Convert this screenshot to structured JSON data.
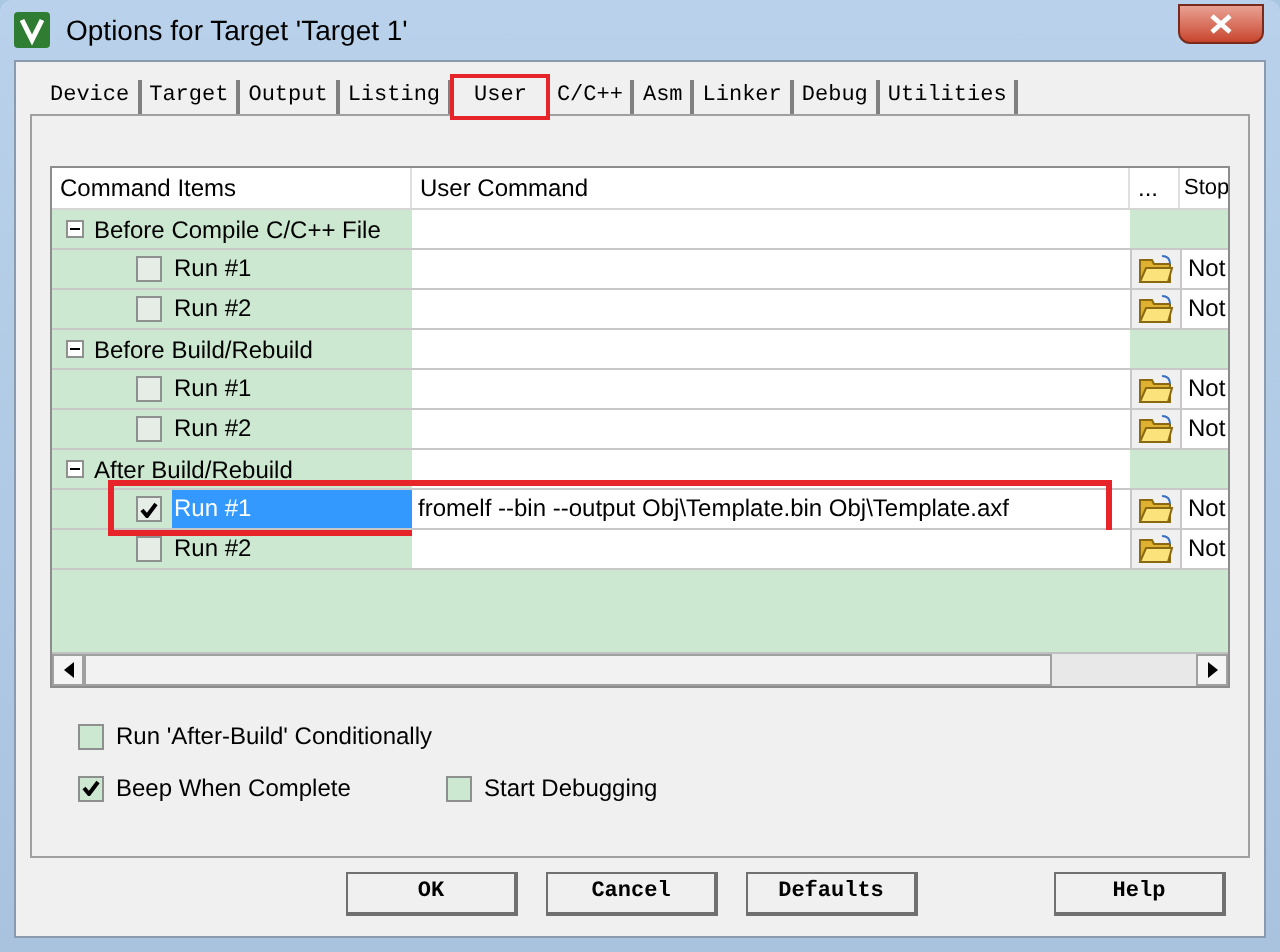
{
  "window": {
    "title": "Options for Target 'Target 1'"
  },
  "tabs": [
    {
      "label": "Device",
      "selected": false,
      "highlighted": false
    },
    {
      "label": "Target",
      "selected": false,
      "highlighted": false
    },
    {
      "label": "Output",
      "selected": false,
      "highlighted": false
    },
    {
      "label": "Listing",
      "selected": false,
      "highlighted": false
    },
    {
      "label": "User",
      "selected": true,
      "highlighted": true
    },
    {
      "label": "C/C++",
      "selected": false,
      "highlighted": false
    },
    {
      "label": "Asm",
      "selected": false,
      "highlighted": false
    },
    {
      "label": "Linker",
      "selected": false,
      "highlighted": false
    },
    {
      "label": "Debug",
      "selected": false,
      "highlighted": false
    },
    {
      "label": "Utilities",
      "selected": false,
      "highlighted": false
    }
  ],
  "table": {
    "columns": [
      "Command Items",
      "User Command",
      "...",
      "Stop"
    ],
    "groups": [
      {
        "label": "Before Compile C/C++ File",
        "expanded": true,
        "children": [
          {
            "label": "Run #1",
            "checked": false,
            "selected": false,
            "highlighted": false,
            "stop": "Not"
          },
          {
            "label": "Run #2",
            "checked": false,
            "selected": false,
            "highlighted": false,
            "stop": "Not"
          }
        ]
      },
      {
        "label": "Before Build/Rebuild",
        "expanded": true,
        "children": [
          {
            "label": "Run #1",
            "checked": false,
            "selected": false,
            "highlighted": false,
            "stop": "Not"
          },
          {
            "label": "Run #2",
            "checked": false,
            "selected": false,
            "highlighted": false,
            "stop": "Not"
          }
        ]
      },
      {
        "label": "After Build/Rebuild",
        "expanded": true,
        "children": [
          {
            "label": "Run #1",
            "checked": true,
            "selected": true,
            "highlighted": true,
            "command": "fromelf --bin --output Obj\\Template.bin Obj\\Template.axf",
            "stop": "Not"
          },
          {
            "label": "Run #2",
            "checked": false,
            "selected": false,
            "highlighted": false,
            "stop": "Not"
          }
        ]
      }
    ]
  },
  "options": [
    {
      "label": "Run 'After-Build' Conditionally",
      "checked": false
    },
    {
      "label": "Beep When Complete",
      "checked": true
    },
    {
      "label": "Start Debugging",
      "checked": false
    }
  ],
  "buttons": [
    "OK",
    "Cancel",
    "Defaults",
    "Help"
  ]
}
